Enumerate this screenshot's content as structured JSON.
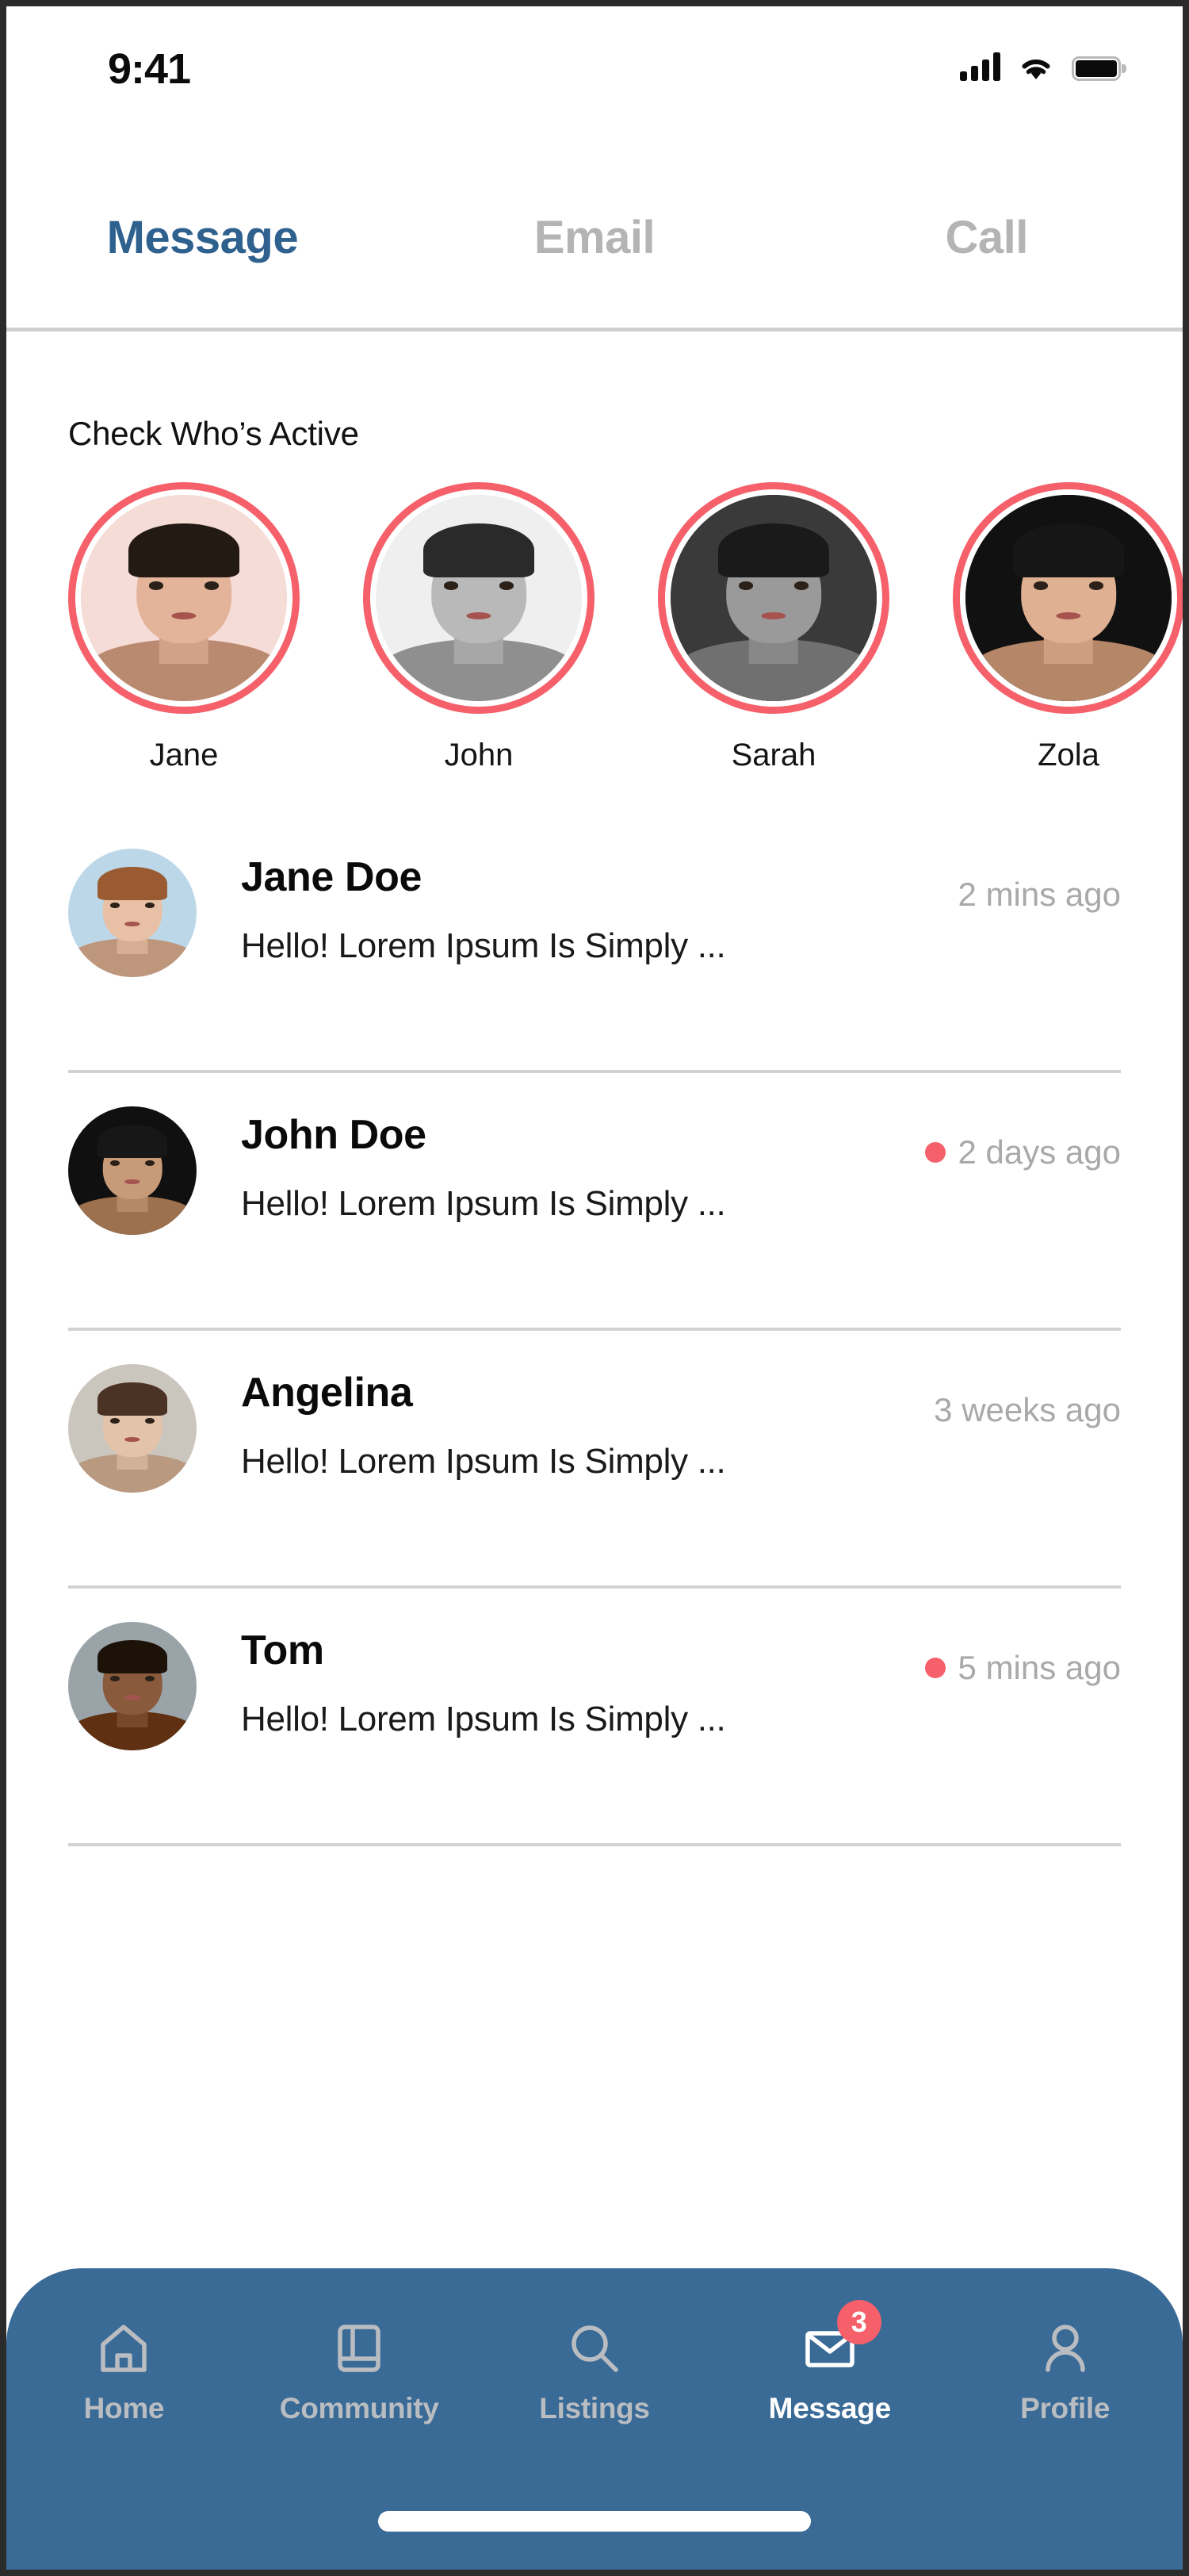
{
  "status_bar": {
    "time": "9:41",
    "icons": [
      "signal-icon",
      "wifi-icon",
      "battery-icon"
    ]
  },
  "top_tabs": {
    "active": "Message",
    "items": [
      {
        "label": "Message",
        "active": true
      },
      {
        "label": "Email",
        "active": false
      },
      {
        "label": "Call",
        "active": false
      }
    ]
  },
  "active_section": {
    "title": "Check Who’s Active",
    "people": [
      {
        "name": "Jane",
        "skin": "#e3b49a",
        "hair": "#231a14",
        "bg": "#f6dcd6",
        "style": "female"
      },
      {
        "name": "John",
        "skin": "#b9b9b9",
        "hair": "#2a2a2a",
        "bg": "#efefef",
        "style": "male-bw"
      },
      {
        "name": "Sarah",
        "skin": "#9a9a9a",
        "hair": "#1a1a1a",
        "bg": "#3a3a3a",
        "style": "female-bw"
      },
      {
        "name": "Zola",
        "skin": "#dfb092",
        "hair": "#161616",
        "bg": "#111111",
        "style": "female"
      }
    ]
  },
  "messages": [
    {
      "name": "Jane Doe",
      "preview": "Hello! Lorem Ipsum Is Simply ...",
      "time": "2 mins ago",
      "unread": false,
      "avatar": {
        "skin": "#e8c0a6",
        "hair": "#9a5a32",
        "bg": "#bcd8e8",
        "style": "female"
      }
    },
    {
      "name": "John Doe",
      "preview": "Hello! Lorem Ipsum Is Simply ...",
      "time": "2 days ago",
      "unread": true,
      "avatar": {
        "skin": "#c79a78",
        "hair": "#171717",
        "bg": "#101010",
        "style": "male"
      }
    },
    {
      "name": "Angelina",
      "preview": "Hello! Lorem Ipsum Is Simply ...",
      "time": "3 weeks ago",
      "unread": false,
      "avatar": {
        "skin": "#e4c3ab",
        "hair": "#4a3225",
        "bg": "#cbc6bd",
        "style": "female"
      }
    },
    {
      "name": "Tom",
      "preview": "Hello! Lorem Ipsum Is Simply ...",
      "time": "5 mins ago",
      "unread": true,
      "avatar": {
        "skin": "#8a5a3c",
        "hair": "#1d1208",
        "bg": "#9aa3a8",
        "style": "male-smile"
      }
    }
  ],
  "bottom_nav": {
    "items": [
      {
        "label": "Home",
        "icon": "home-icon",
        "active": false,
        "badge": null
      },
      {
        "label": "Community",
        "icon": "book-icon",
        "active": false,
        "badge": null
      },
      {
        "label": "Listings",
        "icon": "search-icon",
        "active": false,
        "badge": null
      },
      {
        "label": "Message",
        "icon": "envelope-icon",
        "active": true,
        "badge": "3"
      },
      {
        "label": "Profile",
        "icon": "person-icon",
        "active": false,
        "badge": null
      }
    ]
  },
  "colors": {
    "accent_blue": "#3a6a96",
    "tab_active_blue": "#2f618f",
    "accent_coral": "#f5606a",
    "muted_gray": "#b4b4b4",
    "time_gray": "#a9a9a9",
    "divider": "#d2d2d2",
    "nav_inactive": "#b9bdc1"
  }
}
